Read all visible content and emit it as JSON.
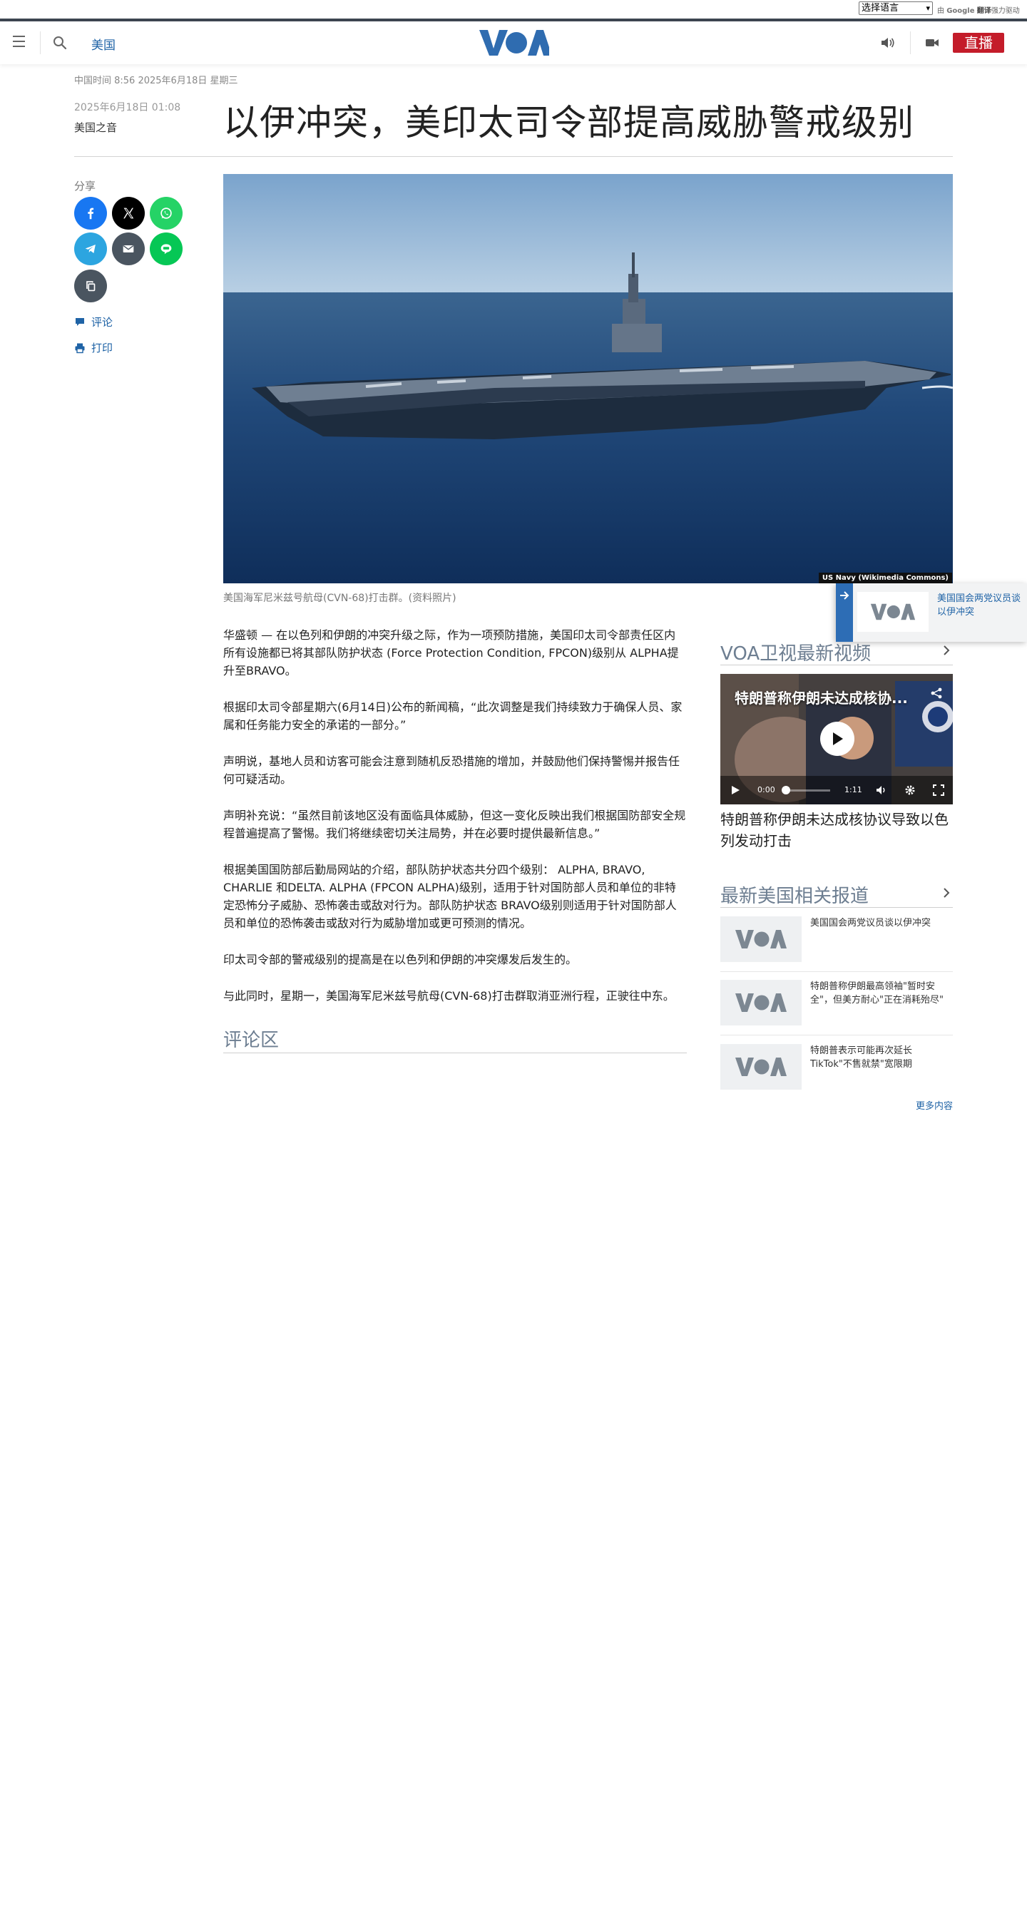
{
  "translate": {
    "select_value": "选择语言",
    "powered_prefix": "由",
    "google": "Google",
    "translate_label": "翻译",
    "powered_suffix": "强力驱动"
  },
  "header": {
    "section": "美国",
    "live_label": "直播",
    "logo_icon": "voa-logo"
  },
  "article": {
    "china_time": "中国时间 8:56 2025年6月18日 星期三",
    "date": "2025年6月18日 01:08",
    "author": "美国之音",
    "title": "以伊冲突，美印太司令部提高威胁警戒级别",
    "image_credit": "US Navy (Wikimedia Commons)",
    "caption": "美国海军尼米兹号航母(CVN-68)打击群。(资料照片)",
    "paragraphs": [
      "华盛顿 — 在以色列和伊朗的冲突升级之际，作为一项预防措施，美国印太司令部责任区内所有设施都已将其部队防护状态 (Force Protection Condition, FPCON)级别从 ALPHA提升至BRAVO。",
      "根据印太司令部星期六(6月14日)公布的新闻稿，“此次调整是我们持续致力于确保人员、家属和任务能力安全的承诺的一部分。”",
      "声明说，基地人员和访客可能会注意到随机反恐措施的增加，并鼓励他们保持警惕并报告任何可疑活动。",
      "声明补充说：“虽然目前该地区没有面临具体威胁，但这一变化反映出我们根据国防部安全规程普遍提高了警惕。我们将继续密切关注局势，并在必要时提供最新信息。”",
      "根据美国国防部后勤局网站的介绍，部队防护状态共分四个级别： ALPHA, BRAVO, CHARLIE 和DELTA. ALPHA (FPCON ALPHA)级别，适用于针对国防部人员和单位的非特定恐怖分子威胁、恐怖袭击或敌对行为。部队防护状态 BRAVO级别则适用于针对国防部人员和单位的恐怖袭击或敌对行为威胁增加或更可预测的情况。",
      "印太司令部的警戒级别的提高是在以色列和伊朗的冲突爆发后发生的。",
      "与此同时，星期一，美国海军尼米兹号航母(CVN-68)打击群取消亚洲行程，正驶往中东。"
    ],
    "comments_title": "评论区"
  },
  "share": {
    "label": "分享",
    "buttons": [
      {
        "name": "facebook",
        "icon": "facebook-icon",
        "color": "#1877f2"
      },
      {
        "name": "x",
        "icon": "x-icon",
        "color": "#000000"
      },
      {
        "name": "whatsapp",
        "icon": "whatsapp-icon",
        "color": "#25d366"
      },
      {
        "name": "telegram",
        "icon": "telegram-icon",
        "color": "#2ca5e0"
      },
      {
        "name": "email",
        "icon": "email-icon",
        "color": "#4a5560"
      },
      {
        "name": "line",
        "icon": "line-icon",
        "color": "#06c755"
      },
      {
        "name": "copy",
        "icon": "copy-link-icon",
        "color": "#4a5560"
      }
    ],
    "comment_label": "评论",
    "print_label": "打印"
  },
  "sidebar": {
    "video_section_title": "VOA卫视最新视频",
    "video": {
      "title": "特朗普称伊朗未达成核协...",
      "current_time": "0:00",
      "duration": "1:11",
      "headline": "特朗普称伊朗未达成核协议导致以色列发动打击"
    },
    "news_section_title": "最新美国相关报道",
    "news": [
      "美国国会两党议员谈以伊冲突",
      "特朗普称伊朗最高领袖\"暂时安全\"，但美方耐心\"正在消耗殆尽\"",
      "特朗普表示可能再次延长TikTok\"不售就禁\"宽限期"
    ],
    "more_label": "更多内容"
  },
  "floating": {
    "text": "美国国会两党议员谈以伊冲突"
  },
  "colors": {
    "brand_blue": "#1f63a6",
    "live_red": "#c41c2a",
    "section_gray": "#6d7e91"
  }
}
